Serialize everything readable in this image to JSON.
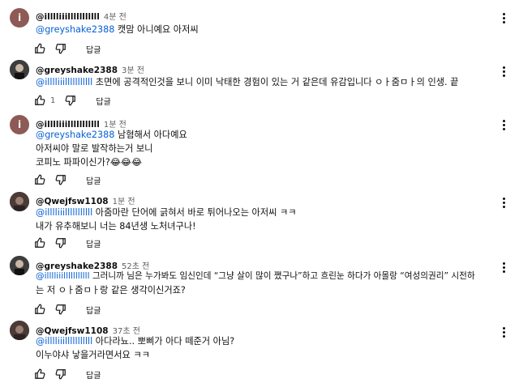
{
  "reply_label": "답글",
  "comments": [
    {
      "author": "@illlliiilllllllllll",
      "time": "4분 전",
      "avatar": "i",
      "lines": [
        {
          "mention": "@greyshake2388",
          "text": " 캣맘 아니예요 아저씨"
        }
      ],
      "likes": ""
    },
    {
      "author": "@greyshake2388",
      "time": "3분 전",
      "avatar": "",
      "lines": [
        {
          "mention": "@illlliiilllllllllll",
          "text": " 초면에 공격적인것을 보니 이미 낙태한 경험이 있는 거 같은데 유감입니다 ㅇㅏ줌ㅁㅏ의 인생. 끝"
        }
      ],
      "likes": "1"
    },
    {
      "author": "@illlliiilllllllllll",
      "time": "1분 전",
      "avatar": "i",
      "lines": [
        {
          "mention": "@greyshake2388",
          "text": " 남혐해서 아다예요"
        },
        {
          "mention": "",
          "text": "아저씨야 말로 발작하는거 보니"
        },
        {
          "mention": "",
          "text": "코피노 파파이신가?😂😂😂"
        }
      ],
      "likes": ""
    },
    {
      "author": "@Qwejfsw1108",
      "time": "1분 전",
      "avatar": "",
      "lines": [
        {
          "mention": "@illlliiilllllllllll",
          "text": " 아줌마란 단어에 긁혀서 바로 튀어나오는 아저씨 ㅋㅋ"
        },
        {
          "mention": "",
          "text": "내가 유추해보니 너는 84년생 노처녀구나!"
        }
      ],
      "likes": ""
    },
    {
      "author": "@greyshake2388",
      "time": "52초 전",
      "avatar": "",
      "lines": [
        {
          "mention": "@illlliiilllllllllll",
          "text": " 그러니까 님은 누가봐도 임신인데 “그냥 살이 많이 쪘구나”하고 흐린눈 하다가 아몰랑 “여성의권리” 시전하"
        },
        {
          "mention": "",
          "text": "는 저 ㅇㅏ줌ㅁㅏ랑 같은 생각이신거죠?"
        }
      ],
      "likes": ""
    },
    {
      "author": "@Qwejfsw1108",
      "time": "37초 전",
      "avatar": "",
      "lines": [
        {
          "mention": "@illlliiilllllllllll",
          "text": " 아다라뇨.. 뽀삐가 아다 떼준거 아님?"
        },
        {
          "mention": "",
          "text": "이누야샤 낳을거라면서요 ㅋㅋ"
        }
      ],
      "likes": ""
    }
  ]
}
